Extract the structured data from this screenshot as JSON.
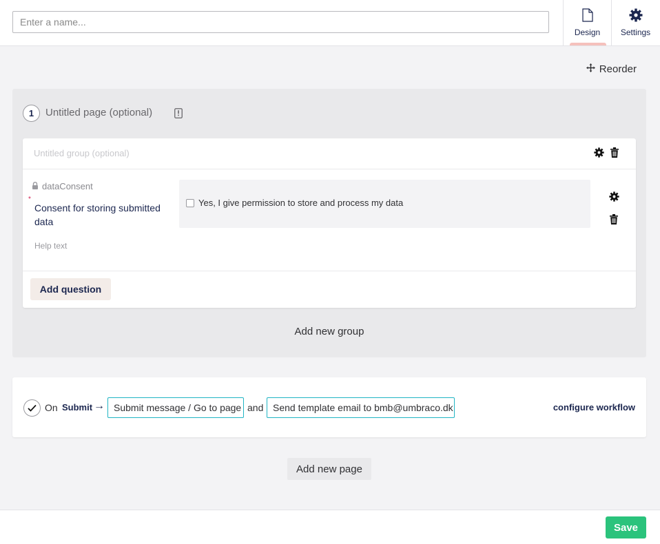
{
  "header": {
    "name_placeholder": "Enter a name...",
    "tabs": [
      {
        "label": "Design",
        "icon": "document-icon"
      },
      {
        "label": "Settings",
        "icon": "gear-icon"
      }
    ]
  },
  "toolbar": {
    "reorder_label": "Reorder"
  },
  "page": {
    "number": "1",
    "title": "Untitled page (optional)",
    "group": {
      "title": "Untitled group (optional)",
      "question": {
        "alias": "dataConsent",
        "required_marker": "*",
        "label": "Consent for storing submitted data",
        "help_text": "Help text",
        "checkbox_label": "Yes, I give permission to store and process my data"
      },
      "add_question_label": "Add question"
    },
    "add_group_label": "Add new group"
  },
  "workflow": {
    "on_label": "On",
    "submit_label": "Submit",
    "arrow": "→",
    "chip1": "Submit message / Go to page",
    "and_label": "and",
    "chip2": "Send template email to bmb@umbraco.dk",
    "configure_label": "configure workflow"
  },
  "add_page_label": "Add new page",
  "footer": {
    "save_label": "Save"
  },
  "colors": {
    "accent": "#2bc37c",
    "chip_border": "#1fb4c4",
    "tab_underline": "#f5c1bc"
  }
}
